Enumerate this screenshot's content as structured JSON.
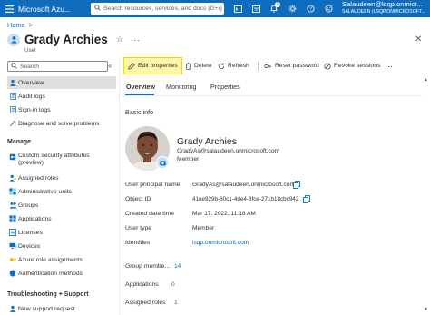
{
  "topbar": {
    "brand": "Microsoft Azu...",
    "search_placeholder": "Search resources, services, and docs (G+/)",
    "notification_count": "1",
    "account_email": "Salaudeen@lsqp.onmicr...",
    "account_tenant": "SALAUDEEN (LSQP.ONMICROSOFT..."
  },
  "breadcrumb": {
    "home": "Home",
    "sep": ">"
  },
  "header": {
    "title": "Grady Archies",
    "subtitle": "User",
    "pin": "☆",
    "more": "···",
    "close": "✕"
  },
  "nav": {
    "search_placeholder": "Search",
    "collapse": "«",
    "items_top": [
      {
        "label": "Overview",
        "icon": "person-icon"
      },
      {
        "label": "Audit logs",
        "icon": "audit-icon"
      },
      {
        "label": "Sign-in logs",
        "icon": "signin-icon"
      },
      {
        "label": "Diagnose and solve problems",
        "icon": "wrench-icon"
      }
    ],
    "manage_heading": "Manage",
    "items_manage": [
      {
        "label": "Custom security attributes",
        "label2": "(preview)"
      },
      {
        "label": "Assigned roles"
      },
      {
        "label": "Administrative units"
      },
      {
        "label": "Groups"
      },
      {
        "label": "Applications"
      },
      {
        "label": "Licenses"
      },
      {
        "label": "Devices"
      },
      {
        "label": "Azure role assignments"
      },
      {
        "label": "Authentication methods"
      }
    ],
    "troubleshooting_heading": "Troubleshooting + Support",
    "items_support": [
      {
        "label": "New support request"
      }
    ]
  },
  "toolbar": {
    "edit": "Edit properties",
    "delete": "Delete",
    "refresh": "Refresh",
    "reset_password": "Reset password",
    "revoke": "Revoke sessions",
    "more": "···"
  },
  "tabs": [
    "Overview",
    "Monitoring",
    "Properties"
  ],
  "basic_info": {
    "title": "Basic info",
    "name": "Grady Archies",
    "email": "GradyAs@salaudeen.onmicrosoft.com",
    "role": "Member",
    "rows": [
      {
        "label": "User principal name",
        "value": "GradyAs@salaudeen.onmicrosoft.com"
      },
      {
        "label": "Object ID",
        "value": "41ee929b-60c1-4de4-8fce-271b18cbc942"
      },
      {
        "label": "Created date time",
        "value": "Mar 17, 2022, 11:18 AM"
      },
      {
        "label": "User type",
        "value": "Member"
      },
      {
        "label": "Identities",
        "value": "lsqp.onmicrosoft.com"
      }
    ],
    "counts": [
      {
        "label": "Group membe...",
        "value": "14"
      },
      {
        "label": "Applications",
        "value": "0"
      },
      {
        "label": "Assigned roles",
        "value": "1"
      }
    ]
  },
  "colors": {
    "accent": "#0f6cbd",
    "highlight": "#fff6a8"
  }
}
